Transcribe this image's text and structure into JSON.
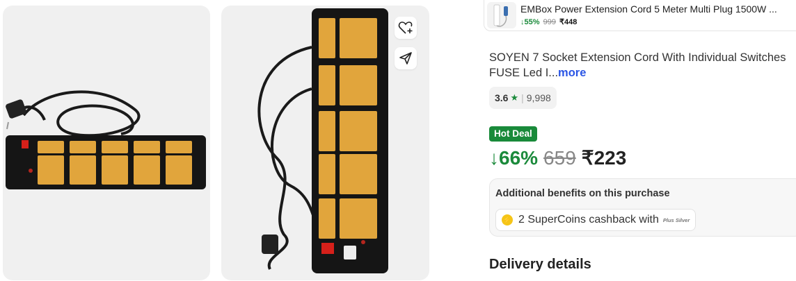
{
  "related_product": {
    "title": "EMBox Power Extension Cord 5 Meter Multi Plug 1500W ...",
    "discount": "↓55%",
    "mrp": "999",
    "price": "₹448"
  },
  "product": {
    "title": "SOYEN 7 Socket Extension Cord With Individual Switches FUSE Led I...",
    "more_label": "more",
    "rating": "3.6",
    "rating_star": "★",
    "rating_count": "9,998",
    "badge": "Hot Deal",
    "discount": "↓66%",
    "mrp": "659",
    "price": "₹223"
  },
  "benefits": {
    "title": "Additional benefits on this purchase",
    "supercoins_text": "2 SuperCoins cashback with",
    "plus_tier": "Plus Silver"
  },
  "delivery": {
    "heading": "Delivery details"
  },
  "colors": {
    "green": "#1b8a3b",
    "link": "#2a55e5"
  }
}
